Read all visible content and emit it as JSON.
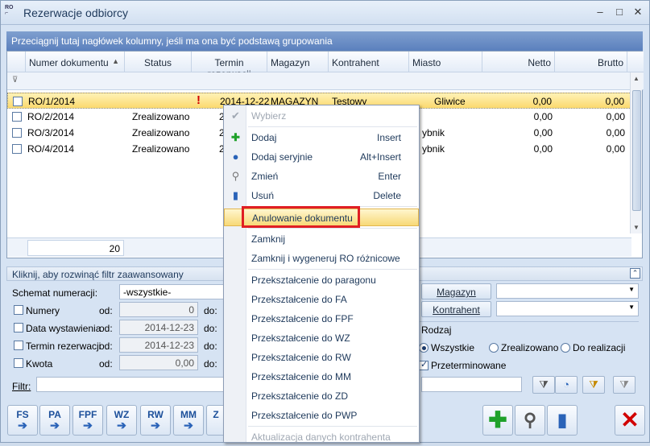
{
  "window": {
    "title": "Rezerwacje odbiorcy",
    "icon_label": "RO"
  },
  "grid": {
    "group_hint": "Przeciągnij tutaj nagłówek kolumny, jeśli ma ona być podstawą grupowania",
    "columns": [
      "Numer dokumentu",
      "Status",
      "Termin rezerwacji",
      "Magazyn",
      "Kontrahent",
      "Miasto",
      "Netto",
      "Brutto"
    ],
    "sort_indicator": "▲",
    "rows": [
      {
        "numer": "RO/1/2014",
        "status": "",
        "flag": "!",
        "termin": "2014-12-22",
        "magazyn": "MAGAZYN",
        "kontrahent": "Testowy",
        "miasto": "Gliwice",
        "netto": "0,00",
        "brutto": "0,00"
      },
      {
        "numer": "RO/2/2014",
        "status": "Zrealizowano",
        "flag": "",
        "termin": "2",
        "magazyn": "",
        "kontrahent": "",
        "miasto": "",
        "netto": "0,00",
        "brutto": "0,00"
      },
      {
        "numer": "RO/3/2014",
        "status": "Zrealizowano",
        "flag": "",
        "termin": "2",
        "magazyn": "",
        "kontrahent": "",
        "miasto": "ybnik",
        "netto": "0,00",
        "brutto": "0,00"
      },
      {
        "numer": "RO/4/2014",
        "status": "Zrealizowano",
        "flag": "",
        "termin": "2",
        "magazyn": "",
        "kontrahent": "",
        "miasto": "ybnik",
        "netto": "0,00",
        "brutto": "0,00"
      }
    ],
    "footer_count": "20"
  },
  "filter": {
    "header": "Kliknij, aby rozwinąć filtr zaawansowany",
    "schemat_label": "Schemat numeracji:",
    "schemat_value": "-wszystkie-",
    "numery_label": "Numery",
    "numery_od_label": "od:",
    "numery_od": "0",
    "numery_do_label": "do:",
    "data_label": "Data wystawienia",
    "data_od_label": "od:",
    "data_od": "2014-12-23",
    "data_do_label": "do:",
    "termin_label": "Termin rezerwacji",
    "termin_od_label": "od:",
    "termin_od": "2014-12-23",
    "termin_do_label": "do:",
    "kwota_label": "Kwota",
    "kwota_od_label": "od:",
    "kwota_od": "0,00",
    "kwota_do_label": "do:",
    "filtr_label": "Filtr:",
    "magazyn_btn": "Magazyn",
    "kontrahent_btn": "Kontrahent",
    "rodzaj_label": "Rodzaj",
    "radio_wszystkie": "Wszystkie",
    "radio_zrealizowano": "Zrealizowano",
    "radio_do_realizacji": "Do realizacji",
    "przeterminowane": "Przeterminowane"
  },
  "toolbar": {
    "buttons": [
      "FS",
      "PA",
      "FPF",
      "WZ",
      "RW",
      "MM",
      "Z"
    ]
  },
  "context_menu": {
    "items": [
      {
        "label": "Wybierz",
        "key": ""
      },
      {
        "label": "Dodaj",
        "key": "Insert"
      },
      {
        "label": "Dodaj seryjnie",
        "key": "Alt+Insert"
      },
      {
        "label": "Zmień",
        "key": "Enter"
      },
      {
        "label": "Usuń",
        "key": "Delete"
      },
      {
        "label": "Anulowanie dokumentu",
        "key": ""
      },
      {
        "label": "Zamknij",
        "key": ""
      },
      {
        "label": "Zamknij i wygeneruj RO różnicowe",
        "key": ""
      },
      {
        "label": "Przekształcenie do paragonu",
        "key": ""
      },
      {
        "label": "Przekształcenie do FA",
        "key": ""
      },
      {
        "label": "Przekształcenie do FPF",
        "key": ""
      },
      {
        "label": "Przekształcenie do WZ",
        "key": ""
      },
      {
        "label": "Przekształcenie do RW",
        "key": ""
      },
      {
        "label": "Przekształcenie do MM",
        "key": ""
      },
      {
        "label": "Przekształcenie do ZD",
        "key": ""
      },
      {
        "label": "Przekształcenie do PWP",
        "key": ""
      },
      {
        "label": "Aktualizacja danych kontrahenta",
        "key": ""
      }
    ]
  },
  "colors": {
    "highlight_box": "#e01e24",
    "selection": "#fbd96e",
    "group_header": "#5b80bd"
  }
}
